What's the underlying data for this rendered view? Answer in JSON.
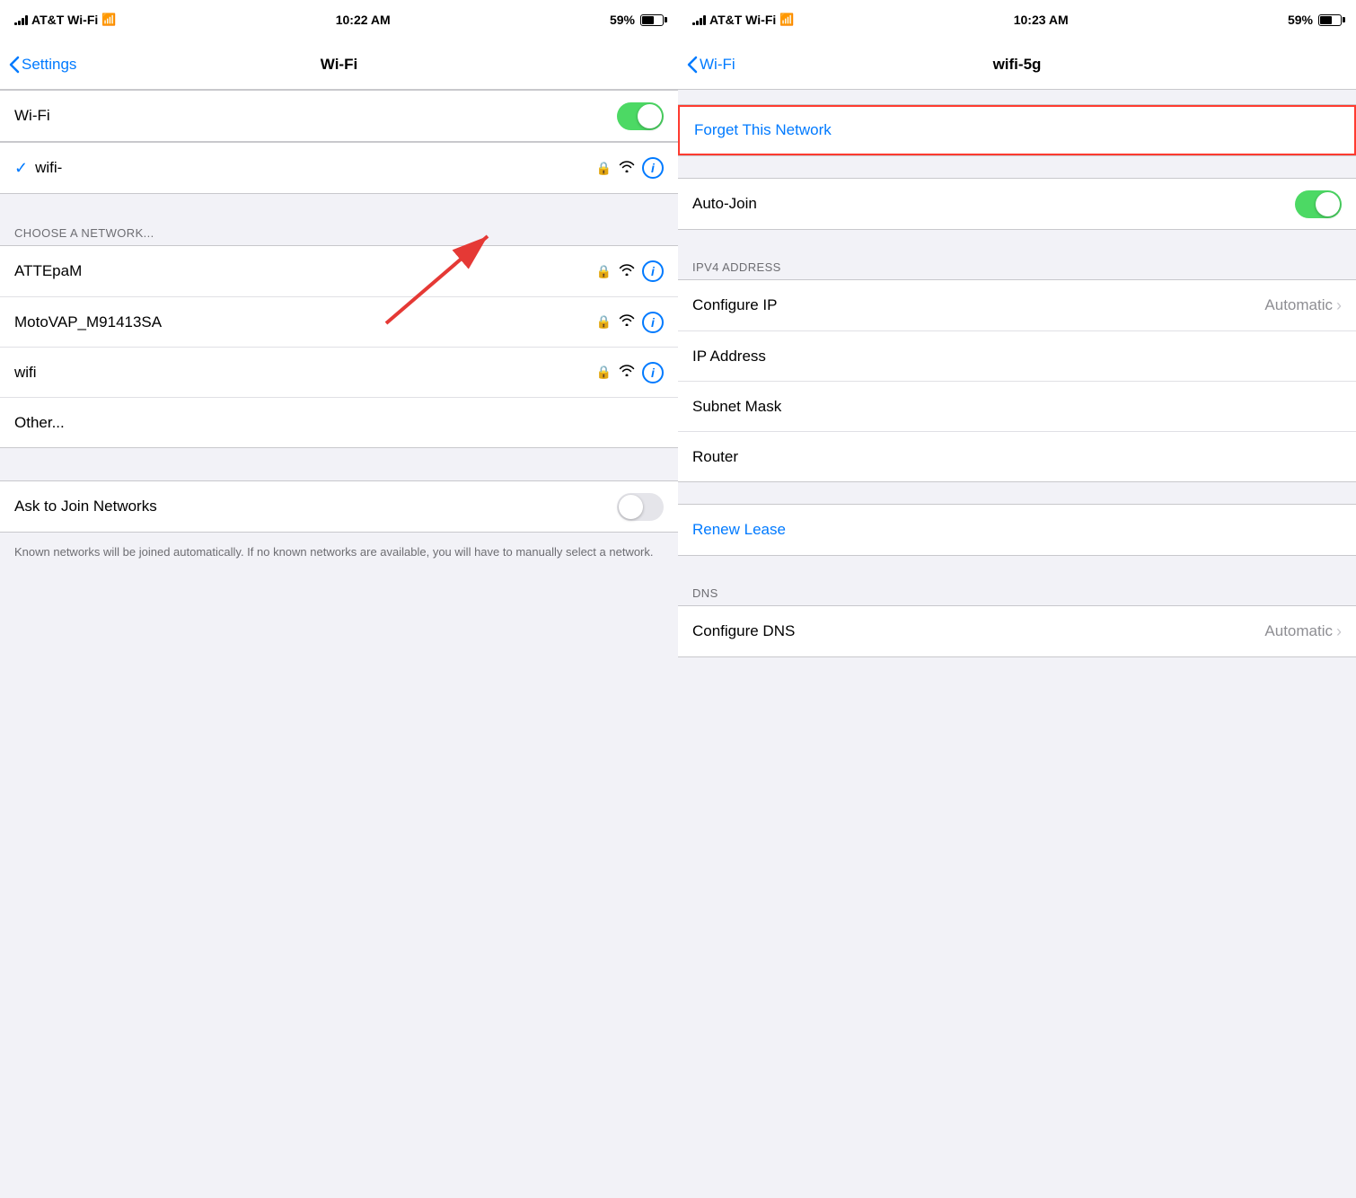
{
  "left_panel": {
    "status": {
      "carrier": "AT&T Wi-Fi",
      "time": "10:22 AM",
      "battery": "59%"
    },
    "nav": {
      "back_label": "Settings",
      "title": "Wi-Fi"
    },
    "wifi_row": {
      "label": "Wi-Fi",
      "toggle_on": true
    },
    "connected_network": {
      "name": "wifi-",
      "checked": true
    },
    "choose_label": "CHOOSE A NETWORK...",
    "networks": [
      {
        "name": "ATTEpaM"
      },
      {
        "name": "MotoVAP_M91413SA"
      },
      {
        "name": "wifi"
      },
      {
        "name": "Other..."
      }
    ],
    "ask_join": {
      "label": "Ask to Join Networks",
      "toggle_on": false
    },
    "footer": "Known networks will be joined automatically. If no known networks are available, you will have to manually select a network."
  },
  "right_panel": {
    "status": {
      "carrier": "AT&T Wi-Fi",
      "time": "10:23 AM",
      "battery": "59%"
    },
    "nav": {
      "back_label": "Wi-Fi",
      "title": "wifi-5g"
    },
    "forget_label": "Forget This Network",
    "auto_join": {
      "label": "Auto-Join",
      "toggle_on": true
    },
    "ipv4_header": "IPV4 ADDRESS",
    "configure_ip": {
      "label": "Configure IP",
      "value": "Automatic"
    },
    "ip_address": {
      "label": "IP Address"
    },
    "subnet_mask": {
      "label": "Subnet Mask"
    },
    "router": {
      "label": "Router"
    },
    "renew_lease": "Renew Lease",
    "dns_header": "DNS",
    "configure_dns": {
      "label": "Configure DNS",
      "value": "Automatic"
    }
  }
}
